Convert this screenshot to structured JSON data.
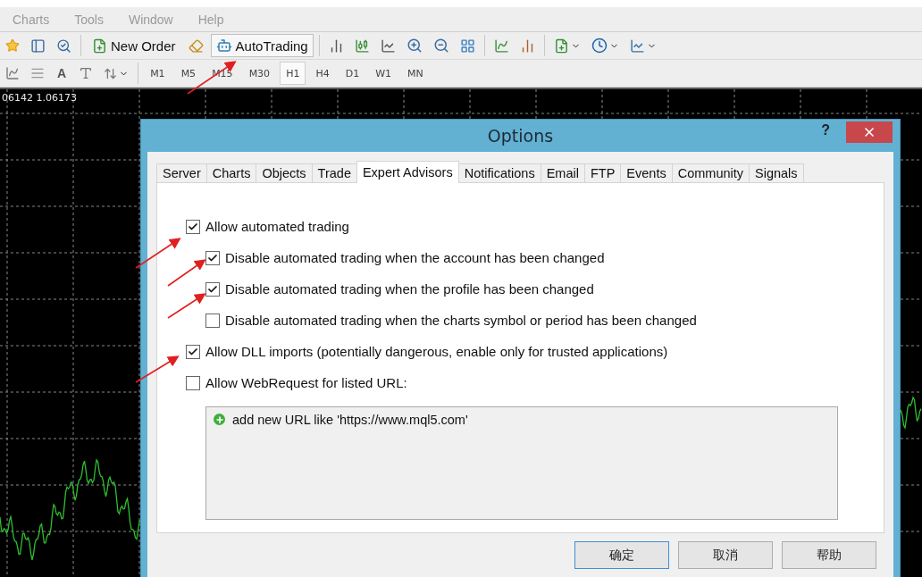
{
  "menu": [
    "Charts",
    "Tools",
    "Window",
    "Help"
  ],
  "toolbar": {
    "new_order": "New Order",
    "autotrading": {
      "label": "AutoTrading",
      "pressed": true
    }
  },
  "toolbar2": {
    "text_tool": "A",
    "timeframes": [
      {
        "label": "M1",
        "selected": false
      },
      {
        "label": "M5",
        "selected": false
      },
      {
        "label": "M15",
        "selected": false
      },
      {
        "label": "M30",
        "selected": false
      },
      {
        "label": "H1",
        "selected": true
      },
      {
        "label": "H4",
        "selected": false
      },
      {
        "label": "D1",
        "selected": false
      },
      {
        "label": "W1",
        "selected": false
      },
      {
        "label": "MN",
        "selected": false
      }
    ]
  },
  "chart": {
    "price_label": "06142 1.06173"
  },
  "dialog": {
    "title": "Options",
    "help": "?",
    "tabs": [
      {
        "label": "Server",
        "selected": false
      },
      {
        "label": "Charts",
        "selected": false
      },
      {
        "label": "Objects",
        "selected": false
      },
      {
        "label": "Trade",
        "selected": false
      },
      {
        "label": "Expert Advisors",
        "selected": true
      },
      {
        "label": "Notifications",
        "selected": false
      },
      {
        "label": "Email",
        "selected": false
      },
      {
        "label": "FTP",
        "selected": false
      },
      {
        "label": "Events",
        "selected": false
      },
      {
        "label": "Community",
        "selected": false
      },
      {
        "label": "Signals",
        "selected": false
      }
    ],
    "options": [
      {
        "label": "Allow automated trading",
        "checked": true,
        "children": [
          {
            "label": "Disable automated trading when the account has been changed",
            "checked": true
          },
          {
            "label": "Disable automated trading when the profile has been changed",
            "checked": true
          },
          {
            "label": "Disable automated trading when the charts symbol or period has been changed",
            "checked": false
          }
        ]
      },
      {
        "label": "Allow DLL imports (potentially dangerous, enable only for trusted applications)",
        "checked": true
      },
      {
        "label": "Allow WebRequest for listed URL:",
        "checked": false
      }
    ],
    "url_list": {
      "add_item": "add new URL like 'https://www.mql5.com'"
    },
    "buttons": [
      {
        "label": "确定",
        "focused": true
      },
      {
        "label": "取消",
        "focused": false
      },
      {
        "label": "帮助",
        "focused": false
      }
    ]
  }
}
